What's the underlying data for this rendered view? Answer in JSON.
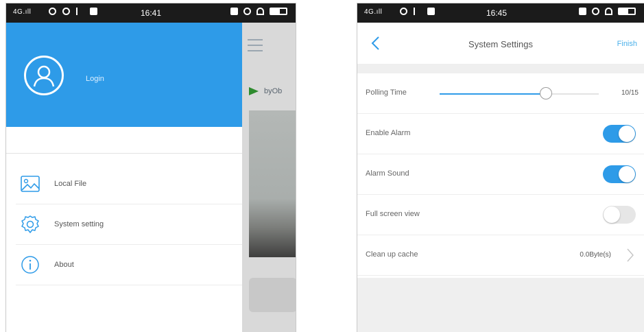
{
  "colors": {
    "accent": "#2e9be8",
    "toggle_on": "#2e9be8",
    "toggle_off": "#e6e6e6",
    "finish": "#4ab0ea"
  },
  "left_screen": {
    "statusbar": {
      "signal": "4G.ıll",
      "time": "16:41"
    },
    "drawer": {
      "avatar_icon": "user-icon",
      "login_label": "Login",
      "items": [
        {
          "icon": "image-icon",
          "label": "Local File"
        },
        {
          "icon": "gear-icon",
          "label": "System setting"
        },
        {
          "icon": "info-icon",
          "label": "About"
        }
      ]
    },
    "background_app": {
      "menu_icon": "hamburger-icon",
      "device_icon": "flag-icon",
      "device_name": "byOb"
    }
  },
  "right_screen": {
    "statusbar": {
      "signal": "4G.ıll",
      "time": "16:45"
    },
    "navbar": {
      "back_icon": "chevron-left-icon",
      "title": "System Settings",
      "finish_label": "Finish"
    },
    "settings": {
      "polling": {
        "label": "Polling Time",
        "value": "10/15",
        "fraction": 0.67
      },
      "enable_alarm": {
        "label": "Enable Alarm",
        "on": true
      },
      "alarm_sound": {
        "label": "Alarm Sound",
        "on": true
      },
      "full_screen": {
        "label": "Full screen view",
        "on": false
      },
      "cache": {
        "label": "Clean up cache",
        "value": "0.0Byte(s)",
        "icon": "chevron-right-icon"
      }
    }
  }
}
